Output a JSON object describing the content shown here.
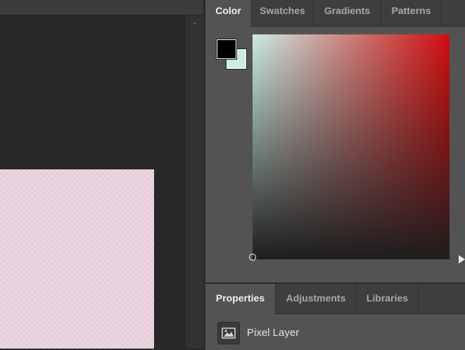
{
  "color_panel": {
    "tabs": [
      {
        "label": "Color",
        "active": true
      },
      {
        "label": "Swatches",
        "active": false
      },
      {
        "label": "Gradients",
        "active": false
      },
      {
        "label": "Patterns",
        "active": false
      }
    ],
    "foreground_color": "#000000",
    "background_color": "#c9ede4",
    "field_hue_color": "#d20d0d"
  },
  "properties_panel": {
    "tabs": [
      {
        "label": "Properties",
        "active": true
      },
      {
        "label": "Adjustments",
        "active": false
      },
      {
        "label": "Libraries",
        "active": false
      }
    ],
    "layer_type_label": "Pixel Layer"
  },
  "icons": {
    "scroll_up": "chevron-up-icon",
    "layer": "pixel-layer-icon"
  },
  "colors": {
    "canvas_bg": "#282828",
    "document_fill": "#ecd6e2",
    "panel_bg": "#535353"
  }
}
